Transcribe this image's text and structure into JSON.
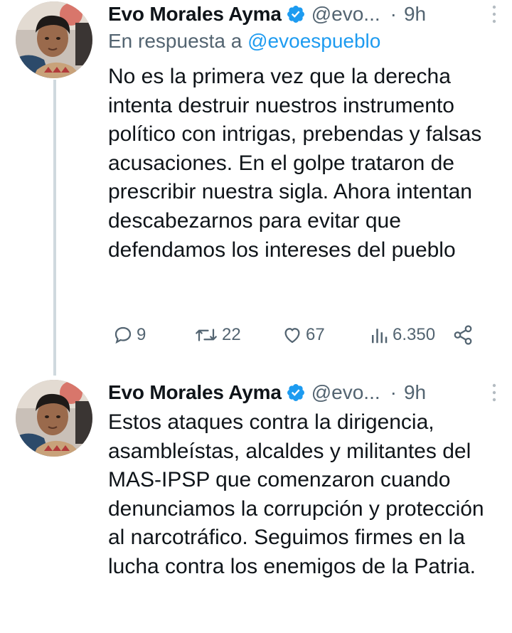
{
  "tweets": [
    {
      "author": {
        "name": "Evo Morales Ayma",
        "handle": "@evo...",
        "avatar_icon": "avatar-photo",
        "verified": true
      },
      "time": "9h",
      "separator": "·",
      "reply_prefix": "En respuesta a",
      "reply_to": "@evoespueblo",
      "text": "No es la primera vez que la derecha intenta destruir nuestros instrumento político con intrigas, prebendas y falsas acusaciones. En el golpe trataron de prescribir nuestra sigla. Ahora intentan descabezarnos para evitar que defendamos los intereses del pueblo",
      "stats": {
        "replies": "9",
        "retweets": "22",
        "likes": "67",
        "views": "6.350"
      }
    },
    {
      "author": {
        "name": "Evo Morales Ayma",
        "handle": "@evo...",
        "avatar_icon": "avatar-photo",
        "verified": true
      },
      "time": "9h",
      "separator": "·",
      "text": "Estos ataques contra la dirigencia, asambleístas, alcaldes y militantes del MAS-IPSP que comenzaron cuando denunciamos la corrupción y protección al narcotráfico. Seguimos firmes en la lucha contra los enemigos de la Patria."
    }
  ],
  "colors": {
    "text_primary": "#0f1419",
    "text_secondary": "#536471",
    "link": "#1d9bf0",
    "verified": "#1d9bf0",
    "thread_line": "#cfd9de"
  }
}
